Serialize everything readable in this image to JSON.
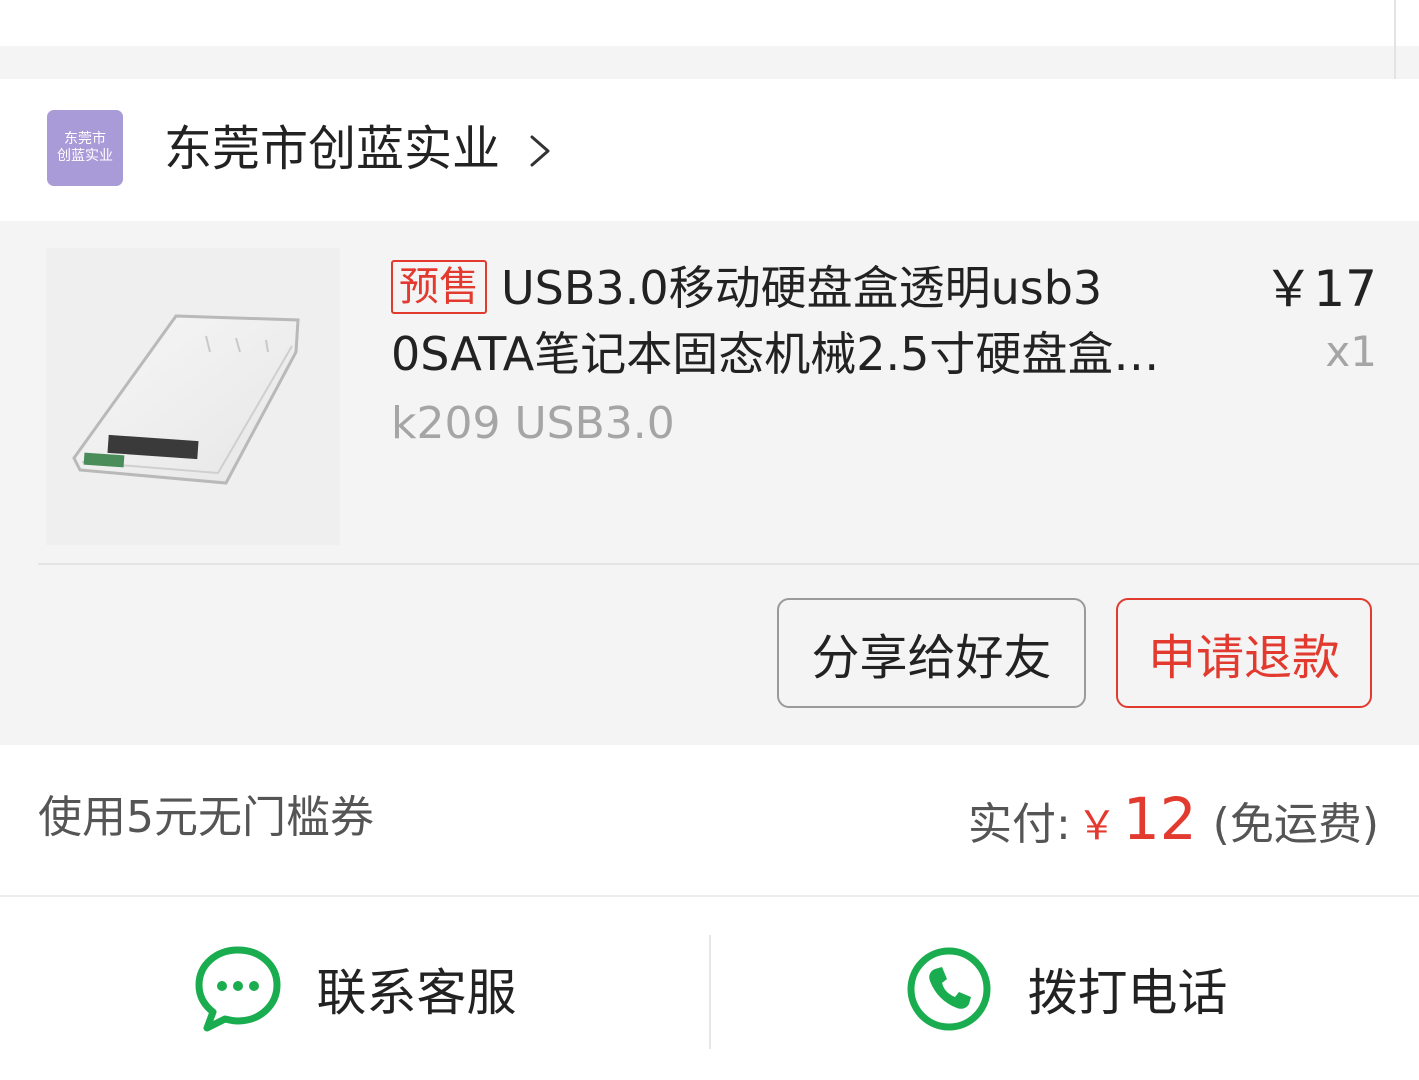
{
  "shop": {
    "logo_text": "东莞市\n创蓝实业",
    "name": "东莞市创蓝实业"
  },
  "item": {
    "presale_tag": "预售",
    "title_line1": "USB3.0移动硬盘盒透明usb3",
    "title_line2": "0SATA笔记本固态机械2.5寸硬盘盒…",
    "spec": "k209 USB3.0",
    "price": "￥17",
    "quantity": "x1"
  },
  "buttons": {
    "share": "分享给好友",
    "refund": "申请退款"
  },
  "summary": {
    "coupon": "使用5元无门槛券",
    "paid_label": "实付:",
    "paid_currency": "￥",
    "paid_amount": "12",
    "paid_note": "(免运费)"
  },
  "bottom_actions": {
    "contact_service": "联系客服",
    "call_phone": "拨打电话"
  },
  "colors": {
    "accent_red": "#e33a2f",
    "wechat_green": "#1aad4f",
    "logo_purple": "#a99ad8"
  }
}
